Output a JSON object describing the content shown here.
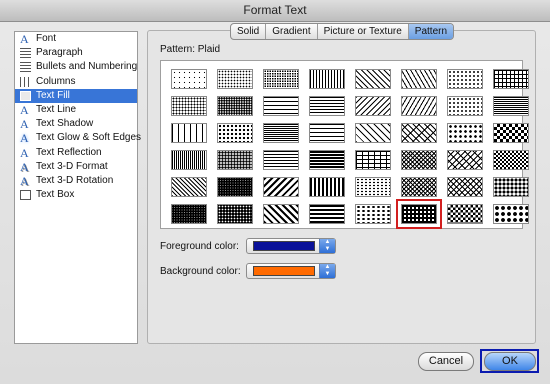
{
  "window": {
    "title": "Format Text"
  },
  "sidebar": {
    "items": [
      {
        "label": "Font",
        "icon": "font-icon",
        "glyph": "A",
        "selected": false
      },
      {
        "label": "Paragraph",
        "icon": "paragraph-icon",
        "glyph": "",
        "selected": false
      },
      {
        "label": "Bullets and Numbering",
        "icon": "bullets-icon",
        "glyph": "",
        "selected": false
      },
      {
        "label": "Columns",
        "icon": "columns-icon",
        "glyph": "",
        "selected": false
      },
      {
        "label": "Text Fill",
        "icon": "text-fill-icon",
        "glyph": "",
        "selected": true
      },
      {
        "label": "Text Line",
        "icon": "text-line-icon",
        "glyph": "A",
        "selected": false
      },
      {
        "label": "Text Shadow",
        "icon": "text-shadow-icon",
        "glyph": "A",
        "selected": false
      },
      {
        "label": "Text Glow & Soft Edges",
        "icon": "text-glow-icon",
        "glyph": "A",
        "selected": false
      },
      {
        "label": "Text Reflection",
        "icon": "text-reflection-icon",
        "glyph": "A",
        "selected": false
      },
      {
        "label": "Text 3-D Format",
        "icon": "text-3d-format-icon",
        "glyph": "A",
        "selected": false
      },
      {
        "label": "Text 3-D Rotation",
        "icon": "text-3d-rotation-icon",
        "glyph": "A",
        "selected": false
      },
      {
        "label": "Text Box",
        "icon": "text-box-icon",
        "glyph": "",
        "selected": false
      }
    ]
  },
  "tabs": [
    {
      "label": "Solid",
      "active": false
    },
    {
      "label": "Gradient",
      "active": false
    },
    {
      "label": "Picture or Texture",
      "active": false
    },
    {
      "label": "Pattern",
      "active": true
    }
  ],
  "pattern": {
    "label": "Pattern:  Plaid",
    "selected_index": 45,
    "icon_names": [
      "pattern-5-percent",
      "pattern-10-percent",
      "pattern-20-percent",
      "pattern-vertical-lines",
      "pattern-diagonal-light",
      "pattern-wave",
      "pattern-dotted-diamond",
      "pattern-small-grid",
      "pattern-dots-medium",
      "pattern-dots-dense",
      "pattern-horizontal-lines",
      "pattern-horizontal-light",
      "pattern-diagonal-wide",
      "pattern-zigzag",
      "pattern-dotted-grid",
      "pattern-horizontal-dense",
      "pattern-sparse-dash",
      "pattern-dark-dots",
      "pattern-narrow-horizontal",
      "pattern-dashed-horizontal",
      "pattern-dashed-diagonal",
      "pattern-diagonal-brick",
      "pattern-large-dots",
      "pattern-large-checker-light",
      "pattern-vertical-dense",
      "pattern-dots-heavy",
      "pattern-light-horizontal",
      "pattern-dark-horizontal",
      "pattern-brick",
      "pattern-weave",
      "pattern-shingle",
      "pattern-checkerboard",
      "pattern-light-diagonal",
      "pattern-dark-stipple",
      "pattern-wide-downward-diagonal",
      "pattern-wide-vertical",
      "pattern-small-confetti",
      "pattern-diagonal-cross",
      "pattern-trellis",
      "pattern-sphere",
      "pattern-heavy-stipple",
      "pattern-dense-black",
      "pattern-wide-upward-diagonal",
      "pattern-wide-horizontal",
      "pattern-large-confetti",
      "pattern-plaid",
      "pattern-solid-diamond",
      "pattern-diamond-grid"
    ]
  },
  "colors": {
    "foreground_label": "Foreground color:",
    "foreground": "#0a1299",
    "background_label": "Background color:",
    "background": "#ff6a00"
  },
  "buttons": {
    "cancel": "Cancel",
    "ok": "OK"
  },
  "accent": {
    "selection": "#3875d7",
    "highlight": "#d21f1f",
    "ok_frame": "#0b1bb0"
  }
}
